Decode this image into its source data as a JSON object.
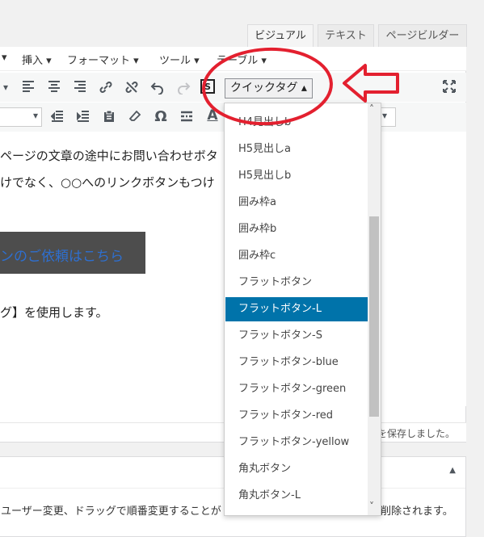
{
  "editor_tabs": [
    "ビジュアル",
    "テキスト",
    "ページビルダー"
  ],
  "menubar": [
    "挿入 ▾",
    "フォーマット ▾",
    "ツール ▾",
    "テーブル ▾"
  ],
  "quicktag": {
    "button_label": "クイックタグ ▴",
    "items": [
      "H4見出しb",
      "H5見出しa",
      "H5見出しb",
      "囲み枠a",
      "囲み枠b",
      "囲み枠c",
      "フラットボタン",
      "フラットボタン-L",
      "フラットボタン-S",
      "フラットボタン-blue",
      "フラットボタン-green",
      "フラットボタン-red",
      "フラットボタン-yellow",
      "角丸ボタン",
      "角丸ボタン-L"
    ],
    "selected_index": 7,
    "scroll_up": "˄",
    "scroll_down": "˅"
  },
  "content": {
    "line1": "ページの文章の途中にお問い合わせボタ",
    "line1_tail": "。",
    "line2": "けでなく、○○へのリンクボタンもつけ",
    "cta": "ンのご依頼はこちら",
    "line3": "グ】を使用します。"
  },
  "status": "を保存しました。",
  "postbox": {
    "toggle": "▲",
    "text": "ユーザー変更、ドラッグで順番変更することが",
    "text_tail": "削除されます。"
  },
  "toolbar_glyphs": {
    "special_char": "Ω",
    "text_color": "A",
    "shortcode": "[S]"
  },
  "colors": {
    "annotation_red": "#e3202f",
    "selected_item": "#0073aa",
    "cta_background": "#4d4d4d",
    "cta_text": "#2e6fcf"
  }
}
